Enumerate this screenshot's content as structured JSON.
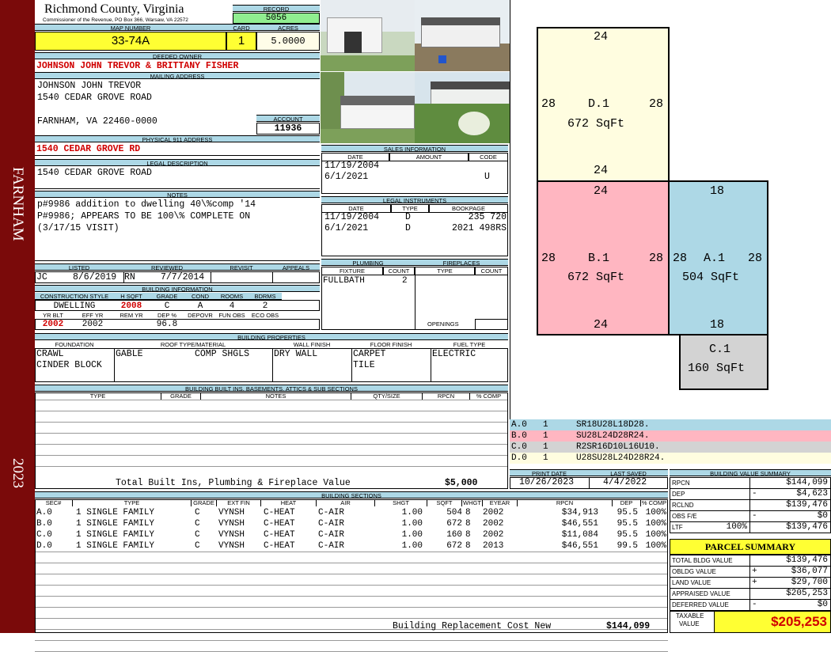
{
  "sidebar": {
    "town": "FARNHAM",
    "year": "2023"
  },
  "header": {
    "county": "Richmond County, Virginia",
    "subtitle": "Commissioner of the Revenue, PO Box 366, Warsaw, VA 22572",
    "record_label": "RECORD",
    "record": "5056",
    "map_label": "MAP NUMBER",
    "map_number": "33-74A",
    "card_label": "CARD",
    "card": "1",
    "acres_label": "ACRES",
    "acres": "5.0000"
  },
  "owner": {
    "label": "DEEDED OWNER",
    "name": "JOHNSON JOHN TREVOR & BRITTANY FISHER",
    "mailing_label": "MAILING ADDRESS",
    "mail1": "JOHNSON JOHN TREVOR",
    "mail2": "1540 CEDAR GROVE ROAD",
    "mail3": "FARNHAM, VA 22460-0000",
    "account_label": "ACCOUNT",
    "account": "11936"
  },
  "address": {
    "label": "PHYSICAL 911 ADDRESS",
    "value": "1540 CEDAR GROVE RD"
  },
  "legal": {
    "label": "LEGAL DESCRIPTION",
    "value": "1540 CEDAR GROVE ROAD"
  },
  "notes": {
    "label": "NOTES",
    "line1": "p#9986 addition to dwelling 40\\%comp '14",
    "line2": "P#9986; APPEARS TO BE 100\\% COMPLETE ON",
    "line3": "(3/17/15 VISIT)"
  },
  "listed": {
    "listed_label": "LISTED",
    "reviewed_label": "REVIEWED",
    "revisit_label": "REVISIT",
    "appeals_label": "APPEALS",
    "lister": "JC",
    "listed_date": "8/6/2019",
    "reviewer": "RN",
    "reviewed_date": "7/7/2014"
  },
  "building_info": {
    "label": "BUILDING INFORMATION",
    "h1": [
      "CONSTRUCTION STYLE",
      "H SQFT",
      "GRADE",
      "COND",
      "ROOMS",
      "BDRMS"
    ],
    "v1": [
      "DWELLING",
      "2008",
      "C",
      "A",
      "4",
      "2"
    ],
    "h2": [
      "YR BLT",
      "EFF YR",
      "REM YR",
      "DEP %",
      "DEPOVR",
      "FUN OBS",
      "ECO OBS"
    ],
    "v2": [
      "2002",
      "2002",
      "",
      "96.8",
      "",
      "",
      ""
    ]
  },
  "sales": {
    "label": "SALES INFORMATION",
    "cols": [
      "DATE",
      "AMOUNT",
      "CODE"
    ],
    "rows": [
      [
        "11/19/2004",
        "",
        ""
      ],
      [
        "6/1/2021",
        "",
        "U"
      ]
    ]
  },
  "instruments": {
    "label": "LEGAL INSTRUMENTS",
    "cols": [
      "DATE",
      "TYPE",
      "BOOKPAGE"
    ],
    "rows": [
      [
        "11/19/2004",
        "D",
        "235 720"
      ],
      [
        "6/1/2021",
        "D",
        "2021 498RS"
      ]
    ]
  },
  "plumbing": {
    "label": "PLUMBING",
    "cols": [
      "FIXTURE",
      "COUNT"
    ],
    "fixture": "FULLBATH",
    "count": "2",
    "fire_label": "FIREPLACES",
    "fire_cols": [
      "TYPE",
      "COUNT"
    ],
    "openings": "OPENINGS"
  },
  "props": {
    "label": "BUILDING PROPERTIES",
    "cols": [
      "FOUNDATION",
      "ROOF TYPE/MATERIAL",
      "WALL FINISH",
      "FLOOR FINISH",
      "FUEL TYPE"
    ],
    "found1": "CRAWL",
    "found2": "CINDER BLOCK",
    "roof1": "GABLE",
    "roof2": "COMP SHGLS",
    "wall": "DRY WALL",
    "floor1": "CARPET",
    "floor2": "TILE",
    "fuel": "ELECTRIC"
  },
  "builtins": {
    "label": "BUILDING BUILT INS, BASEMENTS, ATTICS & SUB SECTIONS",
    "cols": [
      "TYPE",
      "GRADE",
      "NOTES",
      "QTY/SIZE",
      "RPCN",
      "% COMP"
    ],
    "total_label": "Total Built Ins, Plumbing & Fireplace Value",
    "total": "$5,000"
  },
  "print": {
    "print_label": "PRINT DATE",
    "saved_label": "LAST SAVED",
    "print_date": "10/26/2023",
    "saved_date": "4/4/2022"
  },
  "sections": {
    "label": "BUILDING SECTIONS",
    "cols": [
      "SEC#",
      "TYPE",
      "GRADE",
      "EXT FIN",
      "HEAT",
      "AIR",
      "SHGT",
      "SQFT",
      "WHGT",
      "EYEAR",
      "RPCN",
      "DEP",
      "% COMP"
    ],
    "rows": [
      [
        "A.0",
        "1 SINGLE FAMILY",
        "C",
        "VYNSH",
        "C-HEAT",
        "C-AIR",
        "1.00",
        "504",
        "8",
        "2002",
        "$34,913",
        "95.5",
        "100%"
      ],
      [
        "B.0",
        "1 SINGLE FAMILY",
        "C",
        "VYNSH",
        "C-HEAT",
        "C-AIR",
        "1.00",
        "672",
        "8",
        "2002",
        "$46,551",
        "95.5",
        "100%"
      ],
      [
        "C.0",
        "1 SINGLE FAMILY",
        "C",
        "VYNSH",
        "C-HEAT",
        "C-AIR",
        "1.00",
        "160",
        "8",
        "2002",
        "$11,084",
        "95.5",
        "100%"
      ],
      [
        "D.0",
        "1 SINGLE FAMILY",
        "C",
        "VYNSH",
        "C-HEAT",
        "C-AIR",
        "1.00",
        "672",
        "8",
        "2013",
        "$46,551",
        "99.5",
        "100%"
      ]
    ],
    "brcn_label": "Building Replacement Cost New",
    "brcn": "$144,099"
  },
  "sketch": {
    "d": {
      "label": "D.1",
      "area": "672 SqFt",
      "top": "24",
      "bottom": "24",
      "left": "28",
      "right": "28"
    },
    "b": {
      "label": "B.1",
      "area": "672 SqFt",
      "top": "24",
      "bottom": "24",
      "left": "28",
      "right": "28"
    },
    "a": {
      "label": "A.1",
      "area": "504 SqFt",
      "top": "18",
      "bottom": "18",
      "left": "28",
      "right": "28"
    },
    "c": {
      "label": "C.1",
      "area": "160 SqFt"
    },
    "colors": {
      "a": "#add8e6",
      "b": "#ffb6c1",
      "c": "#d3d3d3",
      "d": "#fffde0"
    }
  },
  "legend": [
    {
      "sec": "A.0",
      "n": "1",
      "code": "SR18U28L18D28."
    },
    {
      "sec": "B.0",
      "n": "1",
      "code": "SU28L24D28R24."
    },
    {
      "sec": "C.0",
      "n": "1",
      "code": "R2SR16D10L16U10."
    },
    {
      "sec": "D.0",
      "n": "1",
      "code": "U28SU28L24D28R24."
    }
  ],
  "bvs": {
    "label": "BUILDING VALUE SUMMARY",
    "rows": [
      [
        "RPCN",
        "",
        "$144,099"
      ],
      [
        "DEP",
        "-",
        "$4,623"
      ],
      [
        "RCLND",
        "",
        "$139,476"
      ],
      [
        "OBS F/E",
        "-",
        "$0"
      ],
      [
        "LTF",
        "100%",
        "$139,476"
      ]
    ]
  },
  "parcel": {
    "label": "PARCEL SUMMARY",
    "rows": [
      [
        "TOTAL BLDG VALUE",
        "",
        "$139,476"
      ],
      [
        "OBLDG VALUE",
        "+",
        "$36,077"
      ],
      [
        "LAND VALUE",
        "+",
        "$29,700"
      ],
      [
        "APPRAISED VALUE",
        "",
        "$205,253"
      ],
      [
        "DEFERRED VALUE",
        "-",
        "$0"
      ]
    ],
    "taxable_label1": "TAXABLE",
    "taxable_label2": "VALUE",
    "taxable": "$205,253"
  }
}
